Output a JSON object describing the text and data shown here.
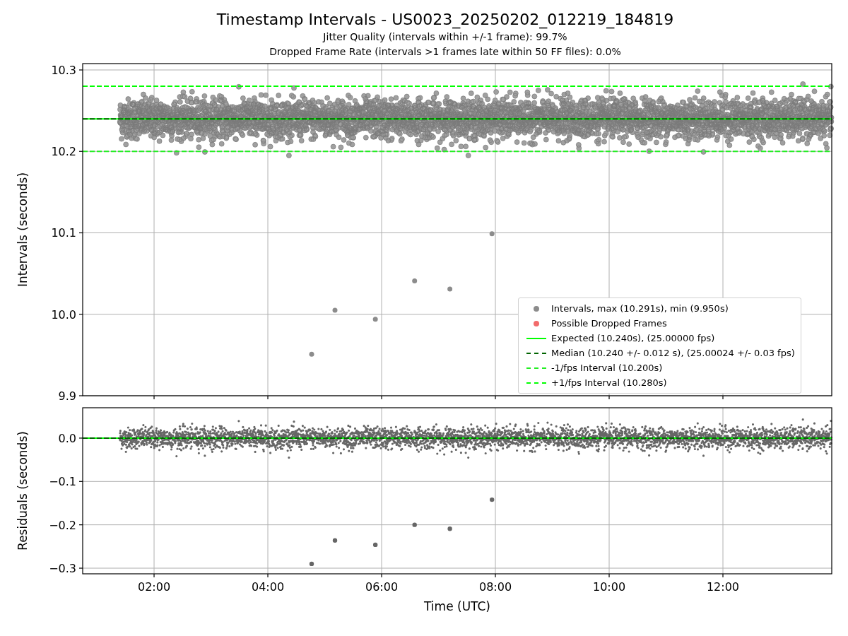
{
  "figure": {
    "title": "Timestamp Intervals - US0023_20250202_012219_184819",
    "subtitles": [
      "Jitter Quality (intervals within +/-1 frame): 99.7%",
      "Dropped Frame Rate (intervals >1 frames late within 50 FF files): 0.0%"
    ]
  },
  "intervals_plot": {
    "chart_data": {
      "type": "scatter",
      "ylabel": "Intervals (seconds)",
      "grid": true,
      "xlim": [
        0.745,
        13.913
      ],
      "ylim": [
        9.9,
        10.3078
      ],
      "yticks": [
        {
          "value": 9.9,
          "label": "9.9"
        },
        {
          "value": 10.0,
          "label": "10.0"
        },
        {
          "value": 10.1,
          "label": "10.1"
        },
        {
          "value": 10.2,
          "label": "10.2"
        },
        {
          "value": 10.3,
          "label": "10.3"
        }
      ],
      "x": [
        4.77,
        5.18,
        5.89,
        6.58,
        7.2,
        7.94
      ],
      "series": [
        {
          "name": "Intervals, max (10.291s), min (9.950s)",
          "color": "#8c8c8c",
          "values": [
            9.951,
            10.005,
            9.994,
            10.041,
            10.031,
            10.099
          ]
        },
        {
          "name": "Possible Dropped Frames",
          "color": "#f26b6b",
          "values": [
            null,
            null,
            null,
            null,
            null,
            null
          ]
        }
      ],
      "ref_lines": [
        {
          "axis": "y",
          "value": 10.24,
          "color": "#00ff00",
          "label": "Expected (10.240s), (25.00000 fps)"
        },
        {
          "axis": "y",
          "value": 10.24,
          "color": "#006400",
          "label": "Median (10.240 +/- 0.012 s), (25.00024 +/- 0.03 fps)"
        },
        {
          "axis": "y",
          "value": 10.2,
          "color": "#22ee22",
          "label": "-1/fps Interval (10.200s)"
        },
        {
          "axis": "y",
          "value": 10.28,
          "color": "#00ff00",
          "label": "+1/fps Interval (10.280s)"
        }
      ]
    }
  },
  "residuals_plot": {
    "chart_data": {
      "type": "scatter",
      "xlabel": "Time (UTC)",
      "ylabel": "Residuals (seconds)",
      "grid": true,
      "xlim": [
        0.745,
        13.913
      ],
      "ylim": [
        -0.313,
        0.07
      ],
      "xticks": [
        {
          "value": 2,
          "label": "02:00"
        },
        {
          "value": 4,
          "label": "04:00"
        },
        {
          "value": 6,
          "label": "06:00"
        },
        {
          "value": 8,
          "label": "08:00"
        },
        {
          "value": 10,
          "label": "10:00"
        },
        {
          "value": 12,
          "label": "12:00"
        }
      ],
      "yticks": [
        {
          "value": -0.3,
          "label": "−0.3"
        },
        {
          "value": -0.2,
          "label": "−0.2"
        },
        {
          "value": -0.1,
          "label": "−0.1"
        },
        {
          "value": 0,
          "label": "0.0"
        }
      ],
      "x": [
        4.77,
        5.18,
        5.89,
        6.58,
        7.2,
        7.94
      ],
      "series": [
        {
          "color": "#666666",
          "values": [
            -0.29,
            -0.236,
            -0.246,
            -0.2,
            -0.209,
            -0.142
          ]
        }
      ],
      "ref_lines": [
        {
          "axis": "y",
          "value": 0,
          "color": "#00ff00"
        },
        {
          "axis": "y",
          "value": 0,
          "color": "#006400"
        }
      ]
    }
  }
}
